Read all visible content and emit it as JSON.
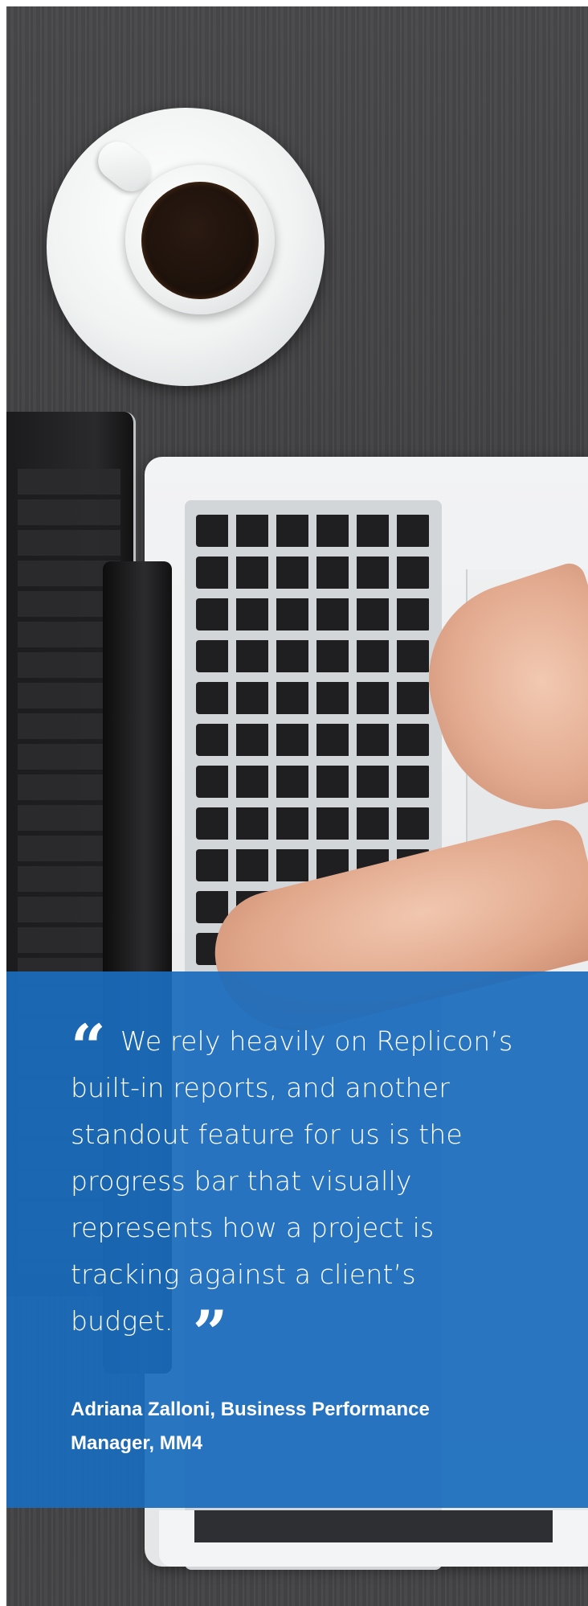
{
  "testimonial": {
    "open_quote": "“",
    "quote": "We rely heavily on Replicon’s built-in reports, and another standout feature for us is the progress bar that visually represents how a project is tracking against a client’s budget.",
    "close_quote": "”",
    "attribution": "Adriana Zalloni, Business Performance Manager, MM4",
    "panel_color": "#1a6cbc"
  },
  "photo": {
    "subject_icons": [
      "coffee-cup-icon",
      "laptop-icon",
      "hands-icon"
    ]
  }
}
